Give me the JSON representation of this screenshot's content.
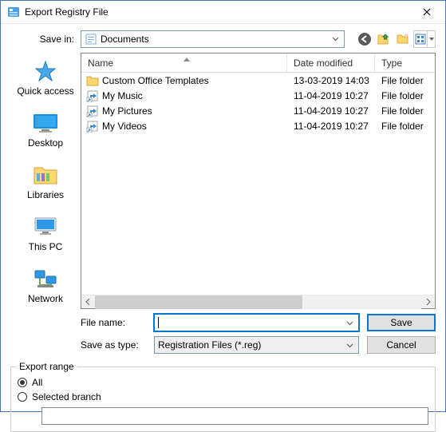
{
  "title": "Export Registry File",
  "save_in_label": "Save in:",
  "save_in_value": "Documents",
  "columns": {
    "name": "Name",
    "date": "Date modified",
    "type": "Type"
  },
  "files": [
    {
      "icon": "folder",
      "name": "Custom Office Templates",
      "date": "13-03-2019 14:03",
      "type": "File folder"
    },
    {
      "icon": "shortcut",
      "name": "My Music",
      "date": "11-04-2019 10:27",
      "type": "File folder"
    },
    {
      "icon": "shortcut",
      "name": "My Pictures",
      "date": "11-04-2019 10:27",
      "type": "File folder"
    },
    {
      "icon": "shortcut",
      "name": "My Videos",
      "date": "11-04-2019 10:27",
      "type": "File folder"
    }
  ],
  "places": [
    {
      "key": "quick-access",
      "label": "Quick access"
    },
    {
      "key": "desktop",
      "label": "Desktop"
    },
    {
      "key": "libraries",
      "label": "Libraries"
    },
    {
      "key": "this-pc",
      "label": "This PC"
    },
    {
      "key": "network",
      "label": "Network"
    }
  ],
  "file_name_label": "File name:",
  "file_name_value": "",
  "save_type_label": "Save as type:",
  "save_type_value": "Registration Files (*.reg)",
  "btn_save": "Save",
  "btn_cancel": "Cancel",
  "export_range": {
    "legend": "Export range",
    "all": "All",
    "selected_branch": "Selected branch",
    "selection": "all",
    "branch_path": ""
  }
}
